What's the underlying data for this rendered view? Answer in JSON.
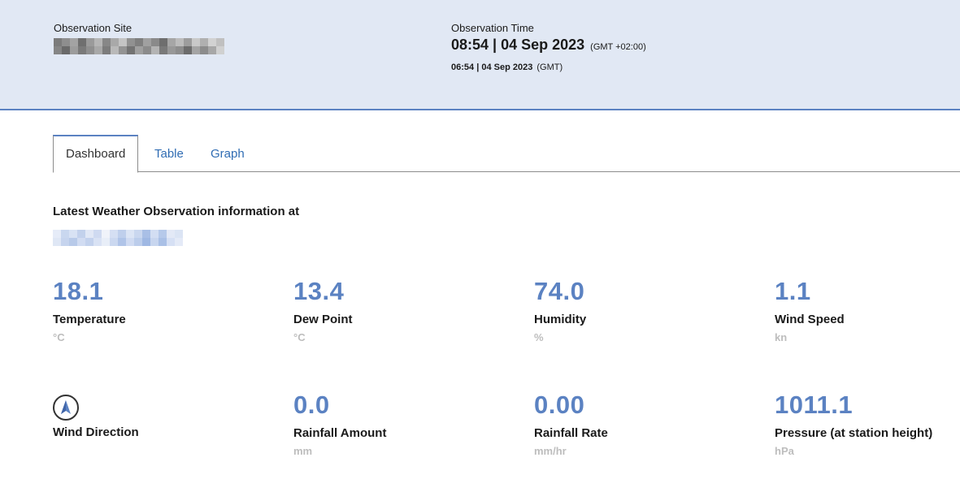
{
  "header": {
    "site_label": "Observation Site",
    "time_label": "Observation Time",
    "local_time": "08:54 | 04 Sep 2023",
    "local_tz": "(GMT +02:00)",
    "gmt_time": "06:54 | 04 Sep 2023",
    "gmt_tz": "(GMT)"
  },
  "tabs": [
    {
      "label": "Dashboard",
      "active": true
    },
    {
      "label": "Table",
      "active": false
    },
    {
      "label": "Graph",
      "active": false
    }
  ],
  "latest_title": "Latest Weather Observation information at",
  "metrics": [
    {
      "value": "18.1",
      "label": "Temperature",
      "unit": "°C"
    },
    {
      "value": "13.4",
      "label": "Dew Point",
      "unit": "°C"
    },
    {
      "value": "74.0",
      "label": "Humidity",
      "unit": "%"
    },
    {
      "value": "1.1",
      "label": "Wind Speed",
      "unit": "kn"
    },
    {
      "icon": "compass-arrow-icon",
      "label": "Wind Direction",
      "unit": ""
    },
    {
      "value": "0.0",
      "label": "Rainfall Amount",
      "unit": "mm"
    },
    {
      "value": "0.00",
      "label": "Rainfall Rate",
      "unit": "mm/hr"
    },
    {
      "value": "1011.1",
      "label": "Pressure (at station height)",
      "unit": "hPa"
    }
  ],
  "colors": {
    "accent": "#5b82c2",
    "header_bg": "#e1e8f4",
    "link": "#2f6cb3",
    "unit_gray": "#bdbdbd"
  }
}
